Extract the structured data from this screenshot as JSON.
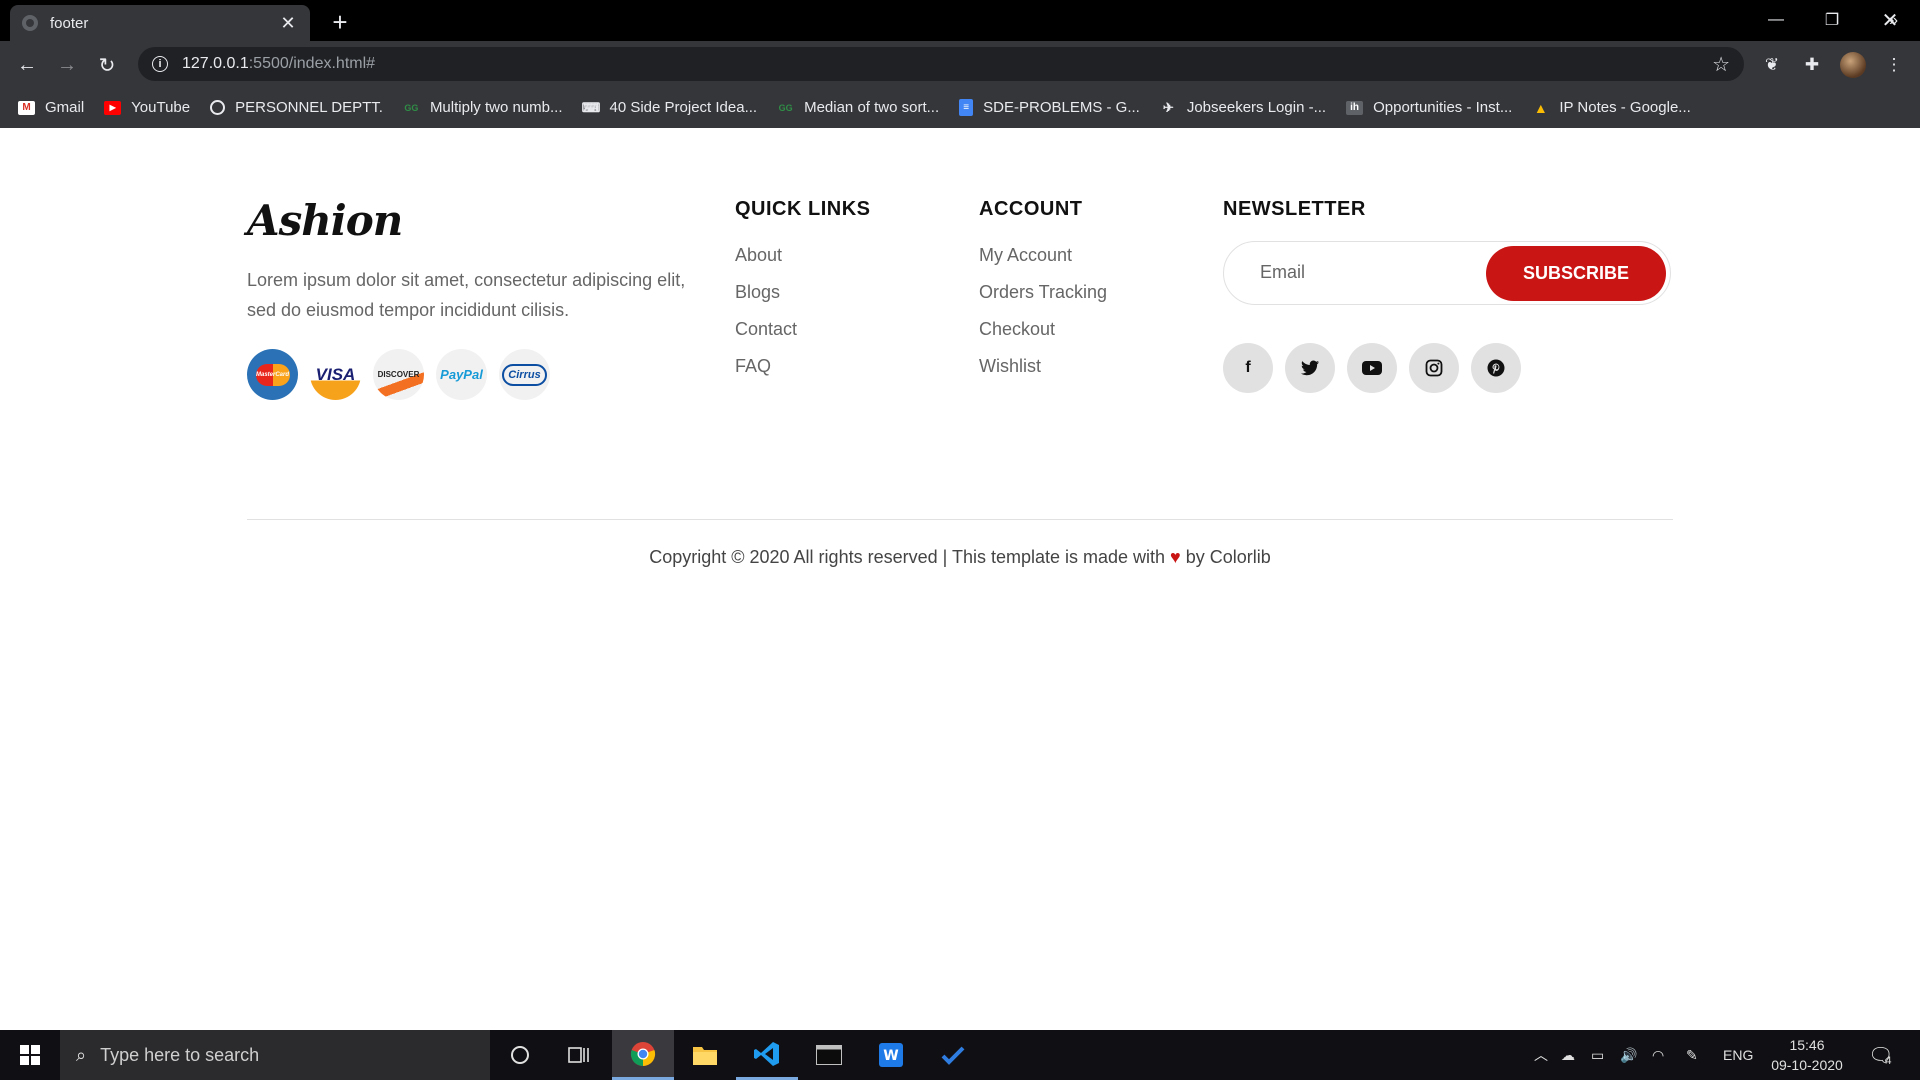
{
  "browser": {
    "tab_title": "footer",
    "tab_close": "✕",
    "new_tab": "+",
    "url_host": "127.0.0.1",
    "url_rest": ":5500/index.html#",
    "bookmarks": [
      {
        "label": "Gmail",
        "icon": "gmail-icon",
        "color": "#d93025"
      },
      {
        "label": "YouTube",
        "icon": "youtube-icon",
        "color": "#ff0000"
      },
      {
        "label": "PERSONNEL DEPTT.",
        "icon": "globe-icon",
        "color": "#e8eaed"
      },
      {
        "label": "Multiply two numb...",
        "icon": "gfg-icon",
        "color": "#2f8d46"
      },
      {
        "label": "40 Side Project Idea...",
        "icon": "fcc-icon",
        "color": "#e8eaed"
      },
      {
        "label": "Median of two sort...",
        "icon": "gfg-icon",
        "color": "#2f8d46"
      },
      {
        "label": "SDE-PROBLEMS - G...",
        "icon": "docs-icon",
        "color": "#4285f4"
      },
      {
        "label": "Jobseekers Login -...",
        "icon": "runner-icon",
        "color": "#e8eaed"
      },
      {
        "label": "Opportunities - Inst...",
        "icon": "internshala-icon",
        "color": "#e8eaed"
      },
      {
        "label": "IP Notes - Google...",
        "icon": "drive-icon",
        "color": "#fbbc04"
      }
    ],
    "bookmarks_more": "»"
  },
  "footer": {
    "logo": "Ashion",
    "about": "Lorem ipsum dolor sit amet, consectetur adipiscing elit, sed do eiusmod tempor incididunt cilisis.",
    "payments": [
      {
        "name": "mastercard-icon",
        "text": "MasterCard"
      },
      {
        "name": "visa-icon",
        "text": "VISA"
      },
      {
        "name": "discover-icon",
        "text": "DISCOVER"
      },
      {
        "name": "paypal-icon",
        "text": "PayPal"
      },
      {
        "name": "cirrus-icon",
        "text": "Cirrus"
      }
    ],
    "quick_links": {
      "title": "QUICK LINKS",
      "items": [
        "About",
        "Blogs",
        "Contact",
        "FAQ"
      ]
    },
    "account": {
      "title": "ACCOUNT",
      "items": [
        "My Account",
        "Orders Tracking",
        "Checkout",
        "Wishlist"
      ]
    },
    "newsletter": {
      "title": "NEWSLETTER",
      "placeholder": "Email",
      "button": "SUBSCRIBE",
      "accent": "#ca1515"
    },
    "socials": [
      {
        "name": "facebook-icon",
        "glyph": "f"
      },
      {
        "name": "twitter-icon",
        "glyph": "🐦"
      },
      {
        "name": "youtube-icon",
        "glyph": "▶"
      },
      {
        "name": "instagram-icon",
        "glyph": "◎"
      },
      {
        "name": "pinterest-icon",
        "glyph": "℗"
      }
    ],
    "copyright_before": "Copyright © 2020 All rights reserved | This template is made with ",
    "heart": "♥",
    "copyright_after": " by Colorlib"
  },
  "taskbar": {
    "search_placeholder": "Type here to search",
    "language": "ENG",
    "time": "15:46",
    "date": "09-10-2020",
    "notifications": "4"
  }
}
